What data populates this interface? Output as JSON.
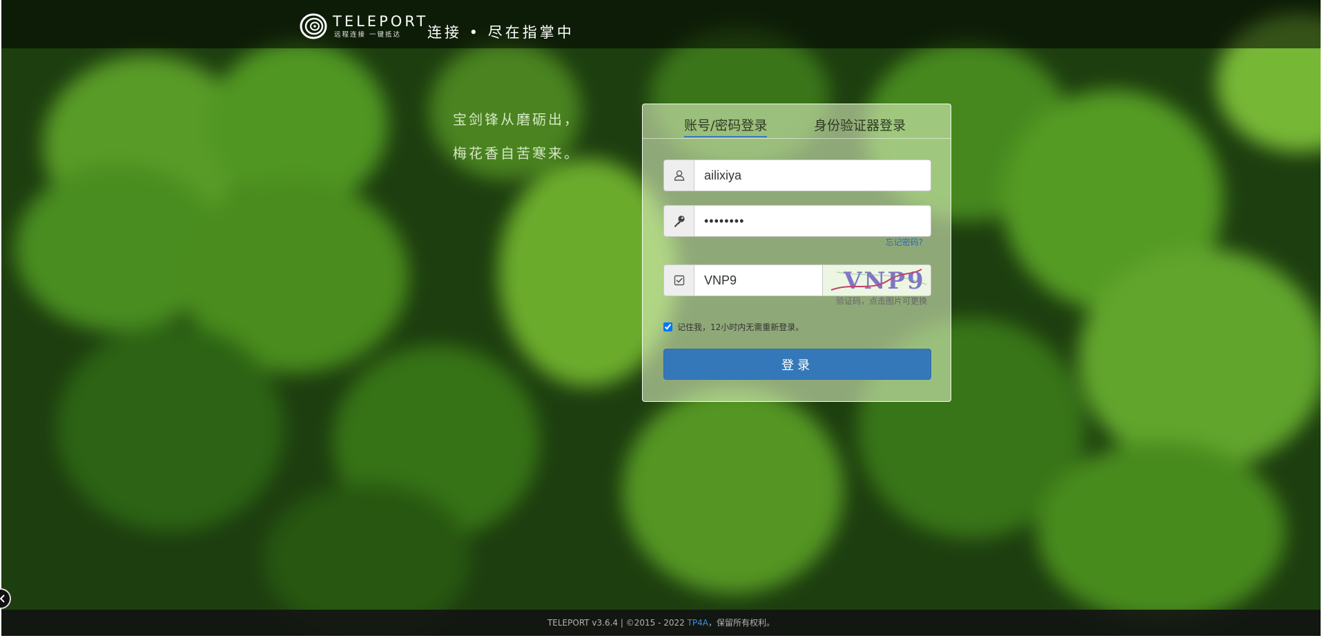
{
  "header": {
    "logo_name": "TELEPORT",
    "logo_tagline": "远程连接 一键抵达",
    "slogan": "连接 • 尽在指掌中"
  },
  "poem": {
    "line1": "宝剑锋从磨砺出，",
    "line2": "梅花香自苦寒来。"
  },
  "login": {
    "tabs": [
      {
        "label": "账号/密码登录",
        "active": true
      },
      {
        "label": "身份验证器登录",
        "active": false
      }
    ],
    "username": "ailixiya",
    "password_mask": "••••••••",
    "forgot_password": "忘记密码?",
    "captcha_value": "VNP9",
    "captcha_image_text": "VNP9",
    "captcha_hint": "验证码，点击图片可更换",
    "remember_label": "记住我，12小时内无需重新登录。",
    "remember_checked": true,
    "submit_label": "登录"
  },
  "footer": {
    "prefix": "TELEPORT v3.6.4 | ©2015 - 2022 ",
    "link": "TP4A",
    "suffix": "，保留所有权利。"
  },
  "colors": {
    "primary": "#3478b9",
    "link": "#2a6db1",
    "captcha_text": "#8074c6",
    "captcha_strike": "#c2416e"
  },
  "icons": {
    "username": "user-icon",
    "password": "key-icon",
    "captcha": "check-square-icon",
    "side_toggle": "chevron-left-icon"
  }
}
